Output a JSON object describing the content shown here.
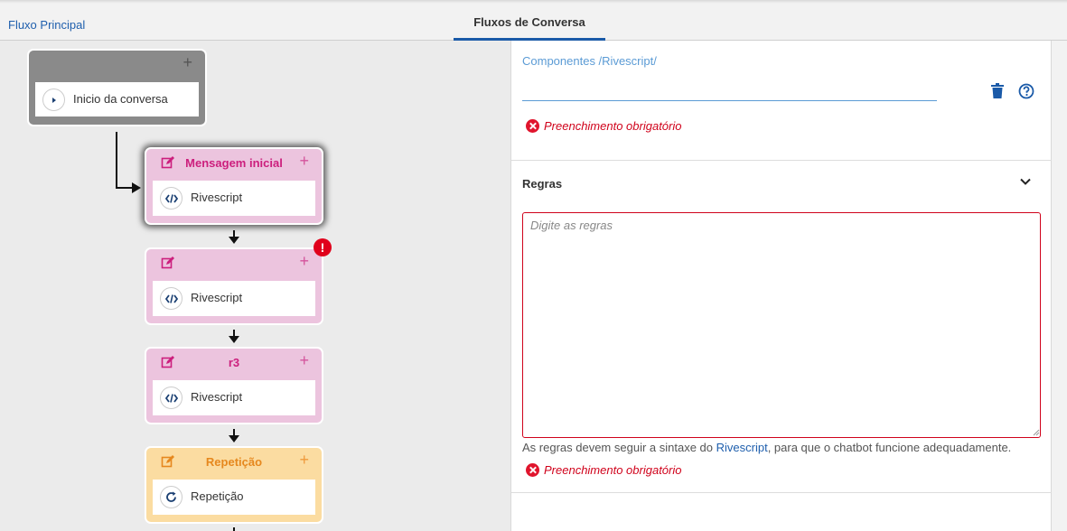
{
  "tabs": {
    "main_flow": "Fluxo Principal",
    "conversation_flows": "Fluxos de Conversa"
  },
  "flow": {
    "start": {
      "label": "Inicio da conversa",
      "plus": "+"
    },
    "nodes": [
      {
        "title": "Mensagem inicial",
        "body": "Rivescript",
        "plus": "+",
        "body_icon": "code-icon",
        "color": "pink"
      },
      {
        "title": "",
        "body": "Rivescript",
        "plus": "+",
        "body_icon": "code-icon",
        "color": "pink"
      },
      {
        "title": "r3",
        "body": "Rivescript",
        "plus": "+",
        "body_icon": "code-icon",
        "color": "pink"
      },
      {
        "title": "Repetição",
        "body": "Repetição",
        "plus": "+",
        "body_icon": "refresh-icon",
        "color": "orange"
      }
    ],
    "error_badge": "!"
  },
  "panel": {
    "component_label": "Componentes /Rivescript/",
    "component_error": "Preenchimento obrigatório",
    "rules_title": "Regras",
    "rules_placeholder": "Digite as regras",
    "rules_value": "",
    "hint_before": "As regras devem seguir a sintaxe do ",
    "hint_link": "Rivescript",
    "hint_after": ", para que o chatbot funcione adequadamente.",
    "rules_error": "Preenchimento obrigatório"
  },
  "colors": {
    "accent": "#1a5aa8",
    "error": "#d0021b",
    "pink_title": "#cc1f7d",
    "orange_title": "#e6881e"
  }
}
